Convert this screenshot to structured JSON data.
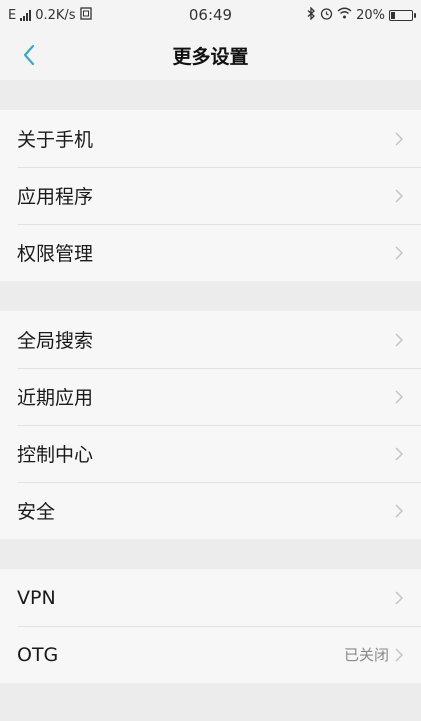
{
  "status_bar": {
    "network": "E",
    "speed": "0.2K/s",
    "time": "06:49",
    "battery_percent": "20%",
    "battery_level": 0.2,
    "icons": [
      "signal-icon",
      "sim-icon",
      "bluetooth-icon",
      "alarm-icon",
      "wifi-icon",
      "battery-icon"
    ]
  },
  "header": {
    "title": "更多设置",
    "back_icon": "chevron-left-icon"
  },
  "groups": [
    {
      "items": [
        {
          "label": "关于手机"
        },
        {
          "label": "应用程序"
        },
        {
          "label": "权限管理"
        }
      ]
    },
    {
      "items": [
        {
          "label": "全局搜索"
        },
        {
          "label": "近期应用"
        },
        {
          "label": "控制中心"
        },
        {
          "label": "安全"
        }
      ]
    },
    {
      "items": [
        {
          "label": "VPN"
        },
        {
          "label": "OTG",
          "value": "已关闭"
        }
      ]
    }
  ],
  "colors": {
    "accent": "#3aa9c9",
    "background": "#ececec",
    "card": "#f7f7f7"
  }
}
